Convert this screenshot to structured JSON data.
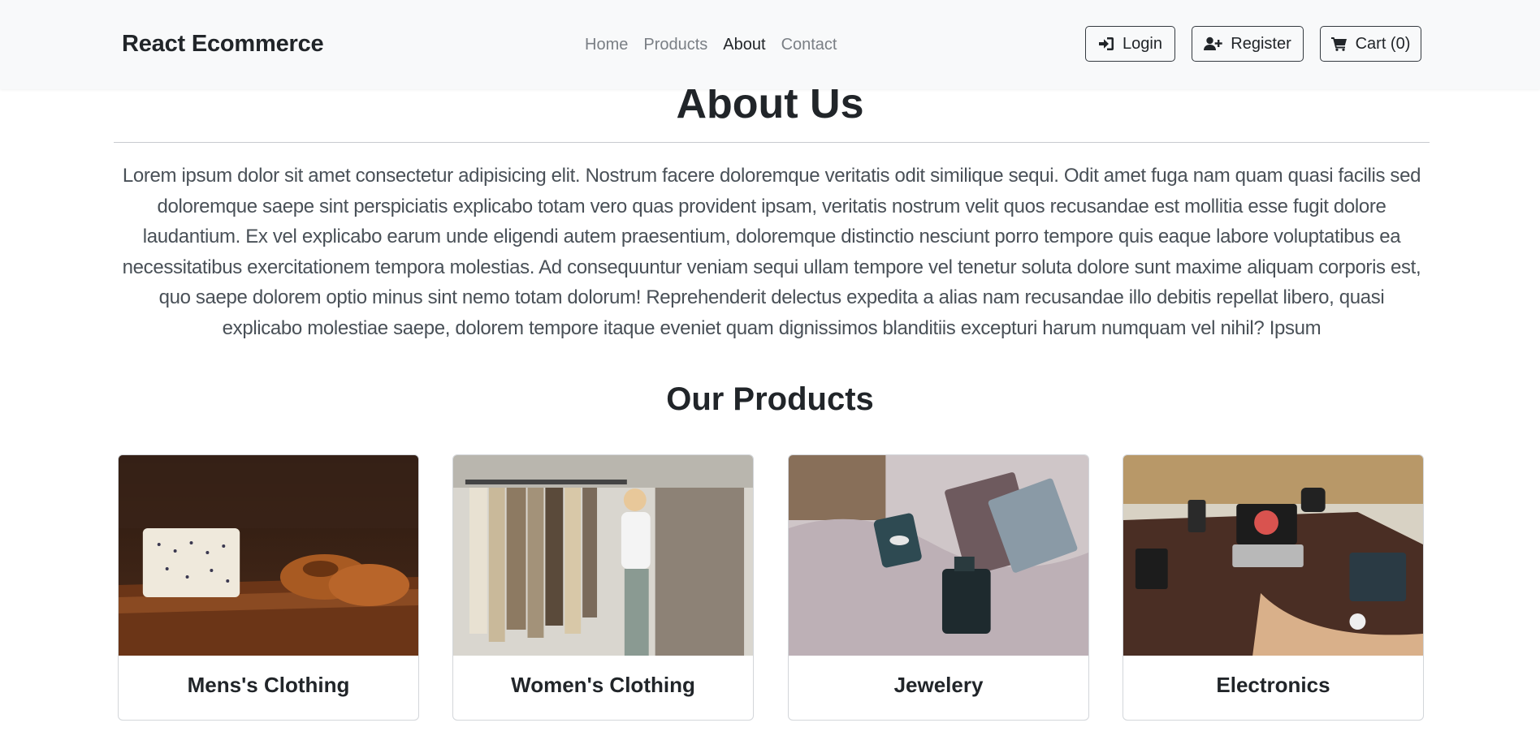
{
  "navbar": {
    "brand": "React Ecommerce",
    "links": [
      "Home",
      "Products",
      "About",
      "Contact"
    ],
    "active_link": "About",
    "login_label": "Login",
    "register_label": "Register",
    "cart_label": "Cart (0)"
  },
  "about": {
    "title": "About Us",
    "body": "Lorem ipsum dolor sit amet consectetur adipisicing elit. Nostrum facere doloremque veritatis odit similique sequi. Odit amet fuga nam quam quasi facilis sed doloremque saepe sint perspiciatis explicabo totam vero quas provident ipsam, veritatis nostrum velit quos recusandae est mollitia esse fugit dolore laudantium. Ex vel explicabo earum unde eligendi autem praesentium, doloremque distinctio nesciunt porro tempore quis eaque labore voluptatibus ea necessitatibus exercitationem tempora molestias. Ad consequuntur veniam sequi ullam tempore vel tenetur soluta dolore sunt maxime aliquam corporis est, quo saepe dolorem optio minus sint nemo totam dolorum! Reprehenderit delectus expedita a alias nam recusandae illo debitis repellat libero, quasi explicabo molestiae saepe, dolorem tempore itaque eveniet quam dignissimos blanditiis excepturi harum numquam vel nihil? Ipsum"
  },
  "products": {
    "title": "Our Products",
    "cards": [
      {
        "label": "Mens's Clothing"
      },
      {
        "label": "Women's Clothing"
      },
      {
        "label": "Jewelery"
      },
      {
        "label": "Electronics"
      }
    ]
  },
  "icons": {
    "login": "sign-in-icon",
    "register": "user-plus-icon",
    "cart": "shopping-cart-icon"
  }
}
